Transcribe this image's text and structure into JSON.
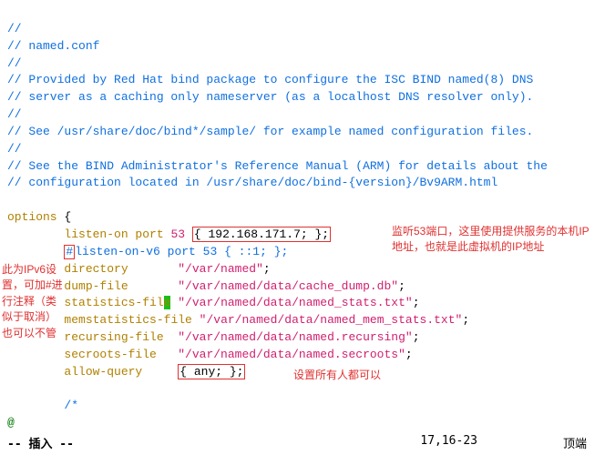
{
  "lines": {
    "l01": "//",
    "l02": "// named.conf",
    "l03": "//",
    "l04": "// Provided by Red Hat bind package to configure the ISC BIND named(8) DNS",
    "l05": "// server as a caching only nameserver (as a localhost DNS resolver only).",
    "l06": "//",
    "l07": "// See /usr/share/doc/bind*/sample/ for example named configuration files.",
    "l08": "//",
    "l09": "// See the BIND Administrator's Reference Manual (ARM) for details about the",
    "l10": "// configuration located in /usr/share/doc/bind-{version}/Bv9ARM.html",
    "opt": "options",
    "brace_open": " {",
    "listen_kw": "listen-on port ",
    "listen_port": "53",
    "listen_val": "{ 192.168.171.7; };",
    "hash": "#",
    "v6_kw": "listen-on-v6 port ",
    "v6_port": "53",
    "v6_rest": " { ::1; };",
    "dir_k": "directory",
    "dir_v": "\"/var/named\"",
    "dump_k": "dump-file",
    "dump_v": "\"/var/named/data/cache_dump.db\"",
    "stat_k1": "statistics-fil",
    "stat_cursor": "e",
    "stat_v": "\"/var/named/data/named_stats.txt\"",
    "mem_k": "memstatistics-file",
    "mem_v": "\"/var/named/data/named_mem_stats.txt\"",
    "rec_k": "recursing-file",
    "rec_v": "\"/var/named/data/named.recursing\"",
    "sec_k": "secroots-file",
    "sec_v": "\"/var/named/data/named.secroots\"",
    "allow_k": "allow-query",
    "allow_v": "{ any; };",
    "cstart": "/*",
    "at": "@",
    "semi": ";"
  },
  "annotations": {
    "right1": "监听53端口，这里使用提供服务的本机IP地址，也就是此虚拟机的IP地址",
    "left1": "此为IPv6设置，可加#进行注释（类似于取消）也可以不管",
    "right2": "设置所有人都可以"
  },
  "status": {
    "mode": "-- 插入 --",
    "pos": "17,16-23",
    "scroll": "顶端"
  }
}
